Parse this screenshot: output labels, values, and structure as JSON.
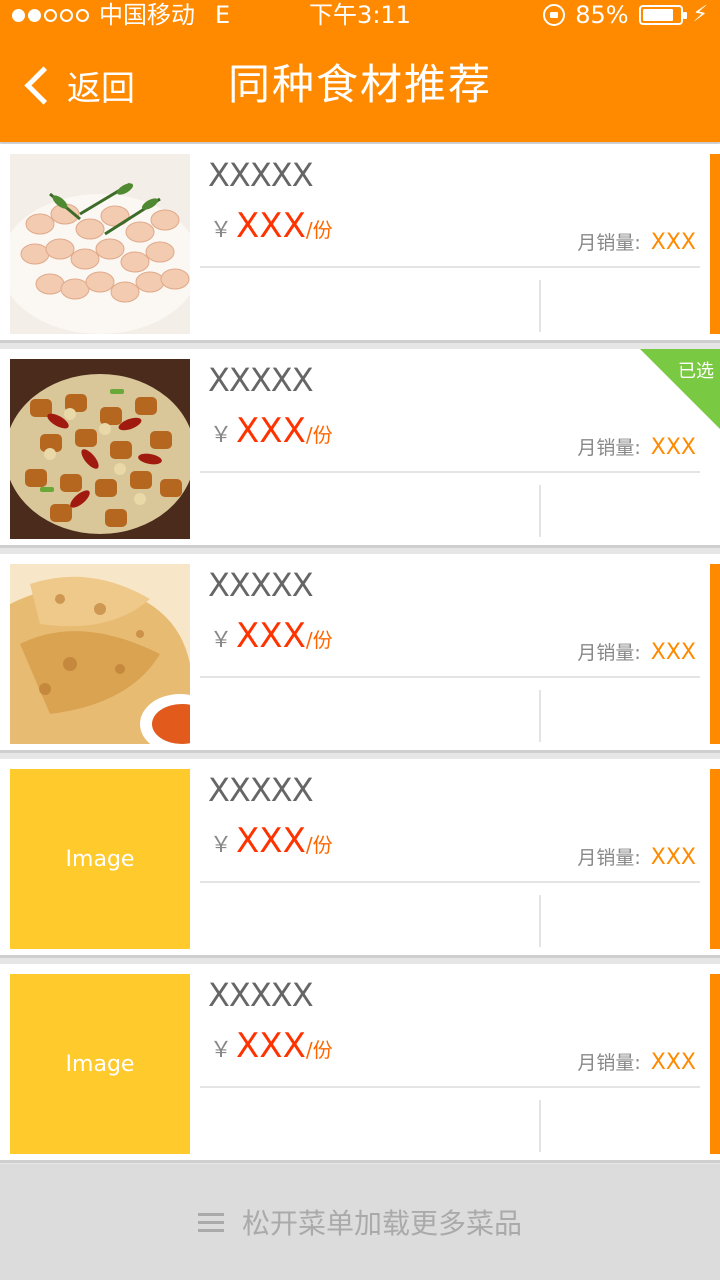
{
  "status_bar": {
    "carrier": "中国移动",
    "network": "E",
    "time": "下午3:11",
    "battery": "85%",
    "signal_bars_filled": 2,
    "signal_bars_total": 5
  },
  "header": {
    "back_label": "返回",
    "title": "同种食材推荐"
  },
  "dishes": [
    {
      "name": "XXXXX",
      "currency": "￥",
      "price": "XXX",
      "unit": "/份",
      "sales_label": "月销量:",
      "sales_value": "XXX",
      "image": "shrimp"
    },
    {
      "name": "XXXXX",
      "currency": "￥",
      "price": "XXX",
      "unit": "/份",
      "sales_label": "月销量:",
      "sales_value": "XXX",
      "image": "kungpao",
      "selected_label": "已选"
    },
    {
      "name": "XXXXX",
      "currency": "￥",
      "price": "XXX",
      "unit": "/份",
      "sales_label": "月销量:",
      "sales_value": "XXX",
      "image": "pancake"
    },
    {
      "name": "XXXXX",
      "currency": "￥",
      "price": "XXX",
      "unit": "/份",
      "sales_label": "月销量:",
      "sales_value": "XXX",
      "image_placeholder": "Image"
    },
    {
      "name": "XXXXX",
      "currency": "￥",
      "price": "XXX",
      "unit": "/份",
      "sales_label": "月销量:",
      "sales_value": "XXX",
      "image_placeholder": "Image"
    }
  ],
  "footer": {
    "label": "松开菜单加载更多菜品"
  },
  "colors": {
    "accent": "#ff8a00",
    "price": "#ff3300",
    "selected_badge": "#7ac943",
    "placeholder": "#ffca2c"
  }
}
